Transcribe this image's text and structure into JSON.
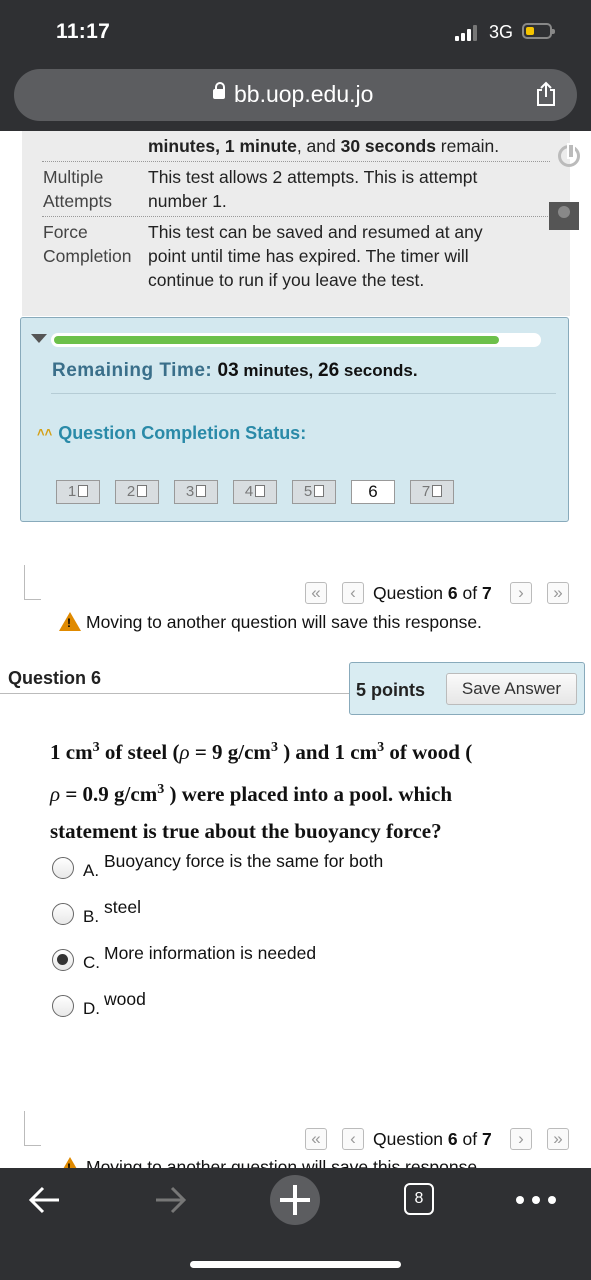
{
  "status_bar": {
    "time": "11:17",
    "network": "3G"
  },
  "browser": {
    "url": "bb.uop.edu.jo",
    "tab_count": "8"
  },
  "test_info": {
    "timer_line": {
      "a": "minutes,",
      "b": "1 minute",
      "c": ", and ",
      "d": "30 seconds",
      "e": " remain."
    },
    "rows": [
      {
        "label_1": "Multiple",
        "label_2": "Attempts",
        "value_1": "This test allows 2 attempts. This is attempt",
        "value_2": "number 1."
      },
      {
        "label_1": "Force",
        "label_2": "Completion",
        "value_1": "This test can be saved and resumed at any",
        "value_2": "point until time has expired. The timer will",
        "value_3": "continue to run if you leave the test."
      }
    ]
  },
  "timer": {
    "progress_fraction": 0.92,
    "remaining_label": "Remaining Time:",
    "remaining_value": {
      "min": "03",
      "min_label": " minutes, ",
      "sec": "26",
      "sec_label": " seconds."
    },
    "completion_status_label": "Question Completion Status:",
    "questions": [
      "1",
      "2",
      "3",
      "4",
      "5",
      "6",
      "7"
    ],
    "current_question": "6"
  },
  "navigation": {
    "question_prefix": "Question ",
    "current": "6",
    "of_text": " of ",
    "total": "7",
    "warning": "Moving to another question will save this response."
  },
  "question": {
    "title": "Question 6",
    "points": "5 points",
    "save_label": "Save Answer",
    "text": {
      "p1": "1 cm",
      "p1_sup": "3",
      "p2": " of steel  (",
      "rho1": "ρ",
      "p3": " = 9 g/cm",
      "p3_sup": "3",
      "p4": " ) and 1 cm",
      "p4_sup": "3",
      "p5": " of wood (",
      "rho2": "ρ",
      "p6": " = 0.9 g/cm",
      "p6_sup": "3",
      "p7": " ) were placed into a pool. which",
      "line3": "statement is true about the buoyancy force?"
    },
    "options": [
      {
        "letter": "A.",
        "text": "Buoyancy force is the same for both",
        "selected": false
      },
      {
        "letter": "B.",
        "text": "steel",
        "selected": false
      },
      {
        "letter": "C.",
        "text": "More information is needed",
        "selected": true
      },
      {
        "letter": "D.",
        "text": "wood",
        "selected": false
      }
    ]
  },
  "colors": {
    "progress": "#6cc04a",
    "panel": "#d3e8ef",
    "accent": "#2a8aa8",
    "warning": "#e08a00"
  }
}
